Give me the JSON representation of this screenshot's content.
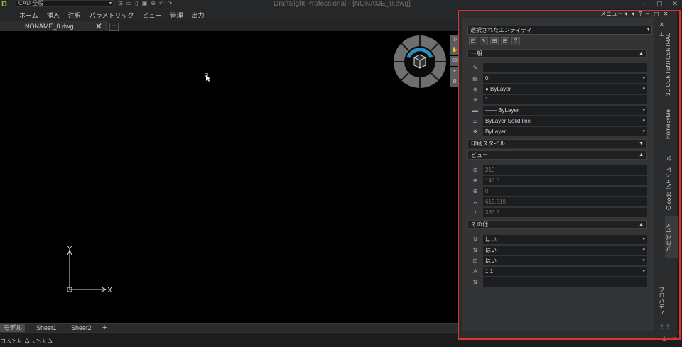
{
  "app": {
    "logo": "D",
    "workspace": "CAD 全般",
    "quick_access": [
      "⊡",
      "▭",
      "▯",
      "▣",
      "⊕",
      "↶",
      "↷"
    ],
    "title": "DraftSight Professional - [NONAME_0.dwg]",
    "controls": {
      "minimize": "–",
      "maximize": "▢",
      "close": "✕"
    }
  },
  "menu": [
    "ホーム",
    "挿入",
    "注釈",
    "パラメトリック",
    "ビュー",
    "管理",
    "出力"
  ],
  "doc_tab": {
    "name": "NONAME_0.dwg",
    "close": "✕",
    "add": "+"
  },
  "navbar_icons": [
    "◎",
    "✋",
    "90",
    "⌖",
    "⚙"
  ],
  "ucs": {
    "x": "X",
    "y": "Y"
  },
  "sheets": [
    {
      "name": "モデル"
    },
    {
      "name": "Sheet1"
    },
    {
      "name": "Sheet2"
    }
  ],
  "sheet_add": "+",
  "command_label": "コマンド ウィンドウ",
  "panel": {
    "menu_label": "メニュー ▾",
    "menu_icons": [
      "▾",
      "?",
      "–",
      "▢",
      "✕"
    ],
    "selector": "選択されたエンティティ",
    "tools": [
      "⊡",
      "↖",
      "⊞",
      "⊟",
      "?"
    ],
    "sections": {
      "general": {
        "title": "一般"
      },
      "print_style": {
        "title": "印刷スタイル"
      },
      "view": {
        "title": "ビュー"
      },
      "misc": {
        "title": "その他"
      }
    },
    "general_rows": [
      {
        "icon": "✎",
        "value": ""
      },
      {
        "icon": "▤",
        "value": "0"
      },
      {
        "icon": "◈",
        "value": "● ByLayer"
      },
      {
        "icon": "≡",
        "value": "1"
      },
      {
        "icon": "▬",
        "value": "—— ByLayer"
      },
      {
        "icon": "☰",
        "value": "ByLayer     Solid line"
      },
      {
        "icon": "❖",
        "value": "ByLayer"
      }
    ],
    "view_rows": [
      {
        "icon": "⊕",
        "value": "210"
      },
      {
        "icon": "⊕",
        "value": "148.5"
      },
      {
        "icon": "⊕",
        "value": "0"
      },
      {
        "icon": "↔",
        "value": "613.519"
      },
      {
        "icon": "↕",
        "value": "385.2"
      }
    ],
    "misc_rows": [
      {
        "icon": "⇅",
        "value": "はい"
      },
      {
        "icon": "⇅",
        "value": "はい"
      },
      {
        "icon": "⊡",
        "value": "はい"
      },
      {
        "icon": "A",
        "value": "1:1"
      },
      {
        "icon": "⇅",
        "value": ""
      }
    ],
    "vertical_tabs": [
      "3D CONTENTCENTRAL",
      "HomeByMe",
      "G-code ジェネレーター",
      "プロパティ"
    ],
    "side_label": "プロパティ"
  }
}
